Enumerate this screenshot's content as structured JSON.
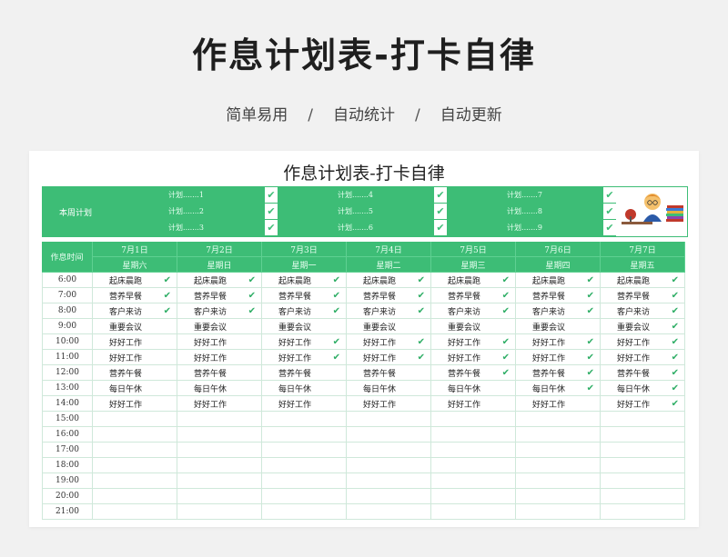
{
  "hero": {
    "title": "作息计划表-打卡自律",
    "subtitle": [
      "简单易用",
      "自动统计",
      "自动更新"
    ],
    "separator": "/"
  },
  "sheet": {
    "title": "作息计划表-打卡自律",
    "plan_label": "本周计划",
    "plans": [
      "计划.......1",
      "计划.......4",
      "计划.......7",
      "计划.......2",
      "计划.......5",
      "计划.......8",
      "计划.......3",
      "计划.......6",
      "计划.......9"
    ],
    "plan_checks": [
      true,
      true,
      true,
      true,
      true,
      true,
      true,
      true,
      true
    ],
    "time_header": "作息时间",
    "days": [
      {
        "date": "7月1日",
        "weekday": "星期六"
      },
      {
        "date": "7月2日",
        "weekday": "星期日"
      },
      {
        "date": "7月3日",
        "weekday": "星期一"
      },
      {
        "date": "7月4日",
        "weekday": "星期二"
      },
      {
        "date": "7月5日",
        "weekday": "星期三"
      },
      {
        "date": "7月6日",
        "weekday": "星期四"
      },
      {
        "date": "7月7日",
        "weekday": "星期五"
      }
    ],
    "check_glyph": "✔",
    "rows": [
      {
        "time": "6:00",
        "tasks": [
          "起床晨跑",
          "起床晨跑",
          "起床晨跑",
          "起床晨跑",
          "起床晨跑",
          "起床晨跑",
          "起床晨跑"
        ],
        "done": [
          true,
          true,
          true,
          true,
          true,
          true,
          true
        ]
      },
      {
        "time": "7:00",
        "tasks": [
          "营养早餐",
          "营养早餐",
          "营养早餐",
          "营养早餐",
          "营养早餐",
          "营养早餐",
          "营养早餐"
        ],
        "done": [
          true,
          true,
          true,
          true,
          true,
          true,
          true
        ]
      },
      {
        "time": "8:00",
        "tasks": [
          "客户来访",
          "客户来访",
          "客户来访",
          "客户来访",
          "客户来访",
          "客户来访",
          "客户来访"
        ],
        "done": [
          true,
          true,
          true,
          true,
          true,
          true,
          true
        ]
      },
      {
        "time": "9:00",
        "tasks": [
          "重要会议",
          "重要会议",
          "重要会议",
          "重要会议",
          "重要会议",
          "重要会议",
          "重要会议"
        ],
        "done": [
          false,
          false,
          false,
          false,
          false,
          false,
          true
        ]
      },
      {
        "time": "10:00",
        "tasks": [
          "好好工作",
          "好好工作",
          "好好工作",
          "好好工作",
          "好好工作",
          "好好工作",
          "好好工作"
        ],
        "done": [
          false,
          false,
          true,
          true,
          true,
          true,
          true
        ]
      },
      {
        "time": "11:00",
        "tasks": [
          "好好工作",
          "好好工作",
          "好好工作",
          "好好工作",
          "好好工作",
          "好好工作",
          "好好工作"
        ],
        "done": [
          false,
          false,
          true,
          true,
          true,
          true,
          true
        ]
      },
      {
        "time": "12:00",
        "tasks": [
          "营养午餐",
          "营养午餐",
          "营养午餐",
          "营养午餐",
          "营养午餐",
          "营养午餐",
          "营养午餐"
        ],
        "done": [
          false,
          false,
          false,
          false,
          true,
          true,
          true
        ]
      },
      {
        "time": "13:00",
        "tasks": [
          "每日午休",
          "每日午休",
          "每日午休",
          "每日午休",
          "每日午休",
          "每日午休",
          "每日午休"
        ],
        "done": [
          false,
          false,
          false,
          false,
          false,
          true,
          true
        ]
      },
      {
        "time": "14:00",
        "tasks": [
          "好好工作",
          "好好工作",
          "好好工作",
          "好好工作",
          "好好工作",
          "好好工作",
          "好好工作"
        ],
        "done": [
          false,
          false,
          false,
          false,
          false,
          false,
          true
        ]
      },
      {
        "time": "15:00",
        "tasks": [
          "",
          "",
          "",
          "",
          "",
          "",
          ""
        ],
        "done": [
          false,
          false,
          false,
          false,
          false,
          false,
          false
        ]
      },
      {
        "time": "16:00",
        "tasks": [
          "",
          "",
          "",
          "",
          "",
          "",
          ""
        ],
        "done": [
          false,
          false,
          false,
          false,
          false,
          false,
          false
        ]
      },
      {
        "time": "17:00",
        "tasks": [
          "",
          "",
          "",
          "",
          "",
          "",
          ""
        ],
        "done": [
          false,
          false,
          false,
          false,
          false,
          false,
          false
        ]
      },
      {
        "time": "18:00",
        "tasks": [
          "",
          "",
          "",
          "",
          "",
          "",
          ""
        ],
        "done": [
          false,
          false,
          false,
          false,
          false,
          false,
          false
        ]
      },
      {
        "time": "19:00",
        "tasks": [
          "",
          "",
          "",
          "",
          "",
          "",
          ""
        ],
        "done": [
          false,
          false,
          false,
          false,
          false,
          false,
          false
        ]
      },
      {
        "time": "20:00",
        "tasks": [
          "",
          "",
          "",
          "",
          "",
          "",
          ""
        ],
        "done": [
          false,
          false,
          false,
          false,
          false,
          false,
          false
        ]
      },
      {
        "time": "21:00",
        "tasks": [
          "",
          "",
          "",
          "",
          "",
          "",
          ""
        ],
        "done": [
          false,
          false,
          false,
          false,
          false,
          false,
          false
        ]
      }
    ]
  },
  "colors": {
    "accent": "#3dbd76",
    "grid_line": "#cfe8da",
    "check": "#2fae66"
  }
}
